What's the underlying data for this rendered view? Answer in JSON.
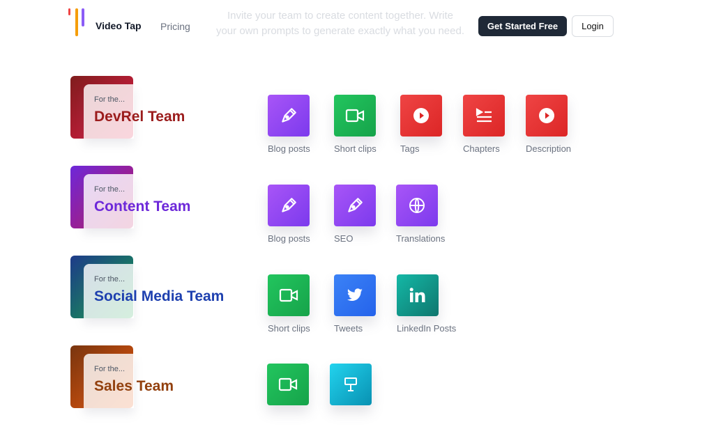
{
  "header": {
    "brand": "Video Tap",
    "pricing_label": "Pricing",
    "faded_line1": "Invite your team to create content together. Write",
    "faded_line2": "your own prompts to generate exactly what you need.",
    "cta_label": "Get Started Free",
    "login_label": "Login"
  },
  "teams": [
    {
      "prefix": "For the...",
      "name": "DevRel Team",
      "color": "#9b1c1c",
      "gradient": [
        "#7f1d1d",
        "#e11d48"
      ],
      "tools": [
        {
          "label": "Blog posts",
          "icon": "pen-nib-icon",
          "color": "purple"
        },
        {
          "label": "Short clips",
          "icon": "video-camera-icon",
          "color": "green"
        },
        {
          "label": "Tags",
          "icon": "play-circle-icon",
          "color": "red"
        },
        {
          "label": "Chapters",
          "icon": "playlist-icon",
          "color": "red"
        },
        {
          "label": "Description",
          "icon": "play-circle-icon",
          "color": "red"
        }
      ]
    },
    {
      "prefix": "For the...",
      "name": "Content Team",
      "color": "#6d28d9",
      "gradient": [
        "#6d28d9",
        "#be185d"
      ],
      "tools": [
        {
          "label": "Blog posts",
          "icon": "pen-nib-icon",
          "color": "purple"
        },
        {
          "label": "SEO",
          "icon": "pen-nib-icon",
          "color": "purple"
        },
        {
          "label": "Translations",
          "icon": "globe-icon",
          "color": "purple"
        }
      ]
    },
    {
      "prefix": "For the...",
      "name": "Social Media Team",
      "color": "#1e40af",
      "gradient": [
        "#1e3a8a",
        "#16a34a"
      ],
      "tools": [
        {
          "label": "Short clips",
          "icon": "video-camera-icon",
          "color": "green"
        },
        {
          "label": "Tweets",
          "icon": "twitter-bird-icon",
          "color": "blue"
        },
        {
          "label": "LinkedIn Posts",
          "icon": "linkedin-icon",
          "color": "teal"
        }
      ]
    },
    {
      "prefix": "For the...",
      "name": "Sales Team",
      "color": "#92400e",
      "gradient": [
        "#78350f",
        "#ea580c"
      ],
      "tools": [
        {
          "label": "",
          "icon": "video-camera-icon",
          "color": "green"
        },
        {
          "label": "",
          "icon": "presentation-icon",
          "color": "cyan"
        }
      ]
    }
  ]
}
